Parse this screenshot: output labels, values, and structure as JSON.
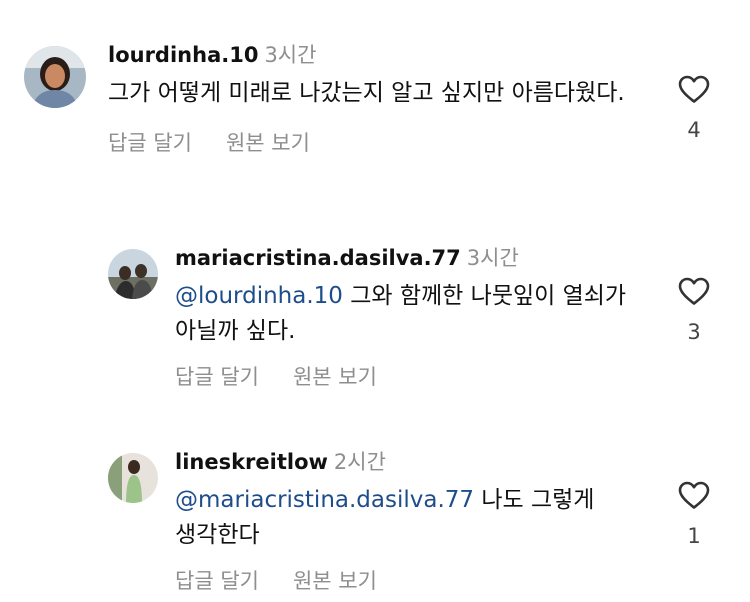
{
  "comments": [
    {
      "username": "lourdinha.10",
      "time": "3시간",
      "mention": "",
      "text": "그가 어떻게 미래로 나갔는지 알고 싶지만 아름다웠다.",
      "likes": "4"
    },
    {
      "username": "mariacristina.dasilva.77",
      "time": "3시간",
      "mention": "@lourdinha.10",
      "text": " 그와 함께한 나뭇잎이 열쇠가 아닐까 싶다.",
      "likes": "3"
    },
    {
      "username": "lineskreitlow",
      "time": "2시간",
      "mention": "@mariacristina.dasilva.77",
      "text": " 나도 그렇게 생각한다",
      "likes": "1"
    }
  ],
  "actions": {
    "reply_label": "답글 달기",
    "original_label": "원본 보기"
  },
  "icons": {
    "like": "heart-outline-icon"
  },
  "colors": {
    "mention": "#1e4d8c",
    "secondary_text": "#8e8e8e"
  }
}
